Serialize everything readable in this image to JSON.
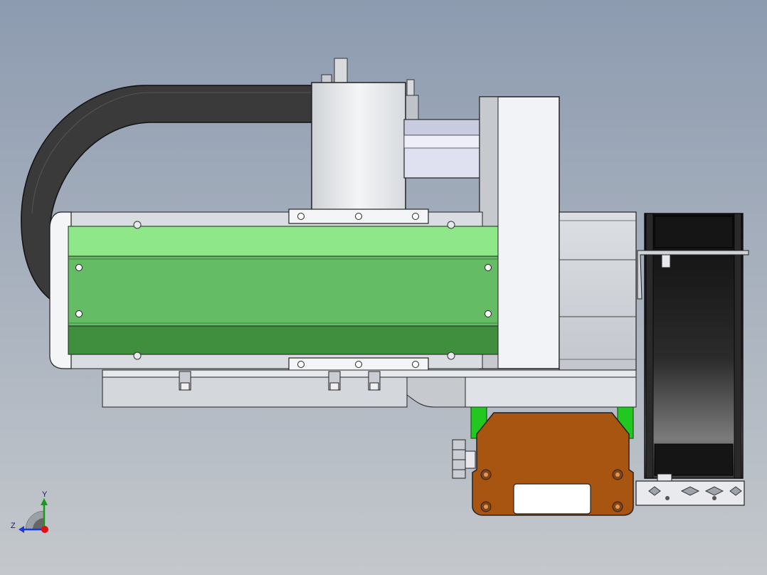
{
  "viewport": {
    "background_top": "#8d9bb0",
    "background_bottom": "#c4c8cc"
  },
  "colors": {
    "cable_chain": "#3a3a3a",
    "actuator_green_light": "#8ee88a",
    "actuator_green_mid": "#64bd64",
    "actuator_green_dark": "#3f8f3f",
    "metal_light": "#e6e8ec",
    "metal_mid": "#c9ccd2",
    "metal_shadow": "#9ea3ab",
    "carriage_brown": "#a85512",
    "rail_green": "#20c820",
    "wheel_dark": "#1b1b1b",
    "outline": "#222222"
  },
  "triad": {
    "y_label": "Y",
    "z_label": "Z",
    "y_color": "#1a9a1a",
    "z_color": "#1a3ad8",
    "x_color": "#e01010"
  }
}
